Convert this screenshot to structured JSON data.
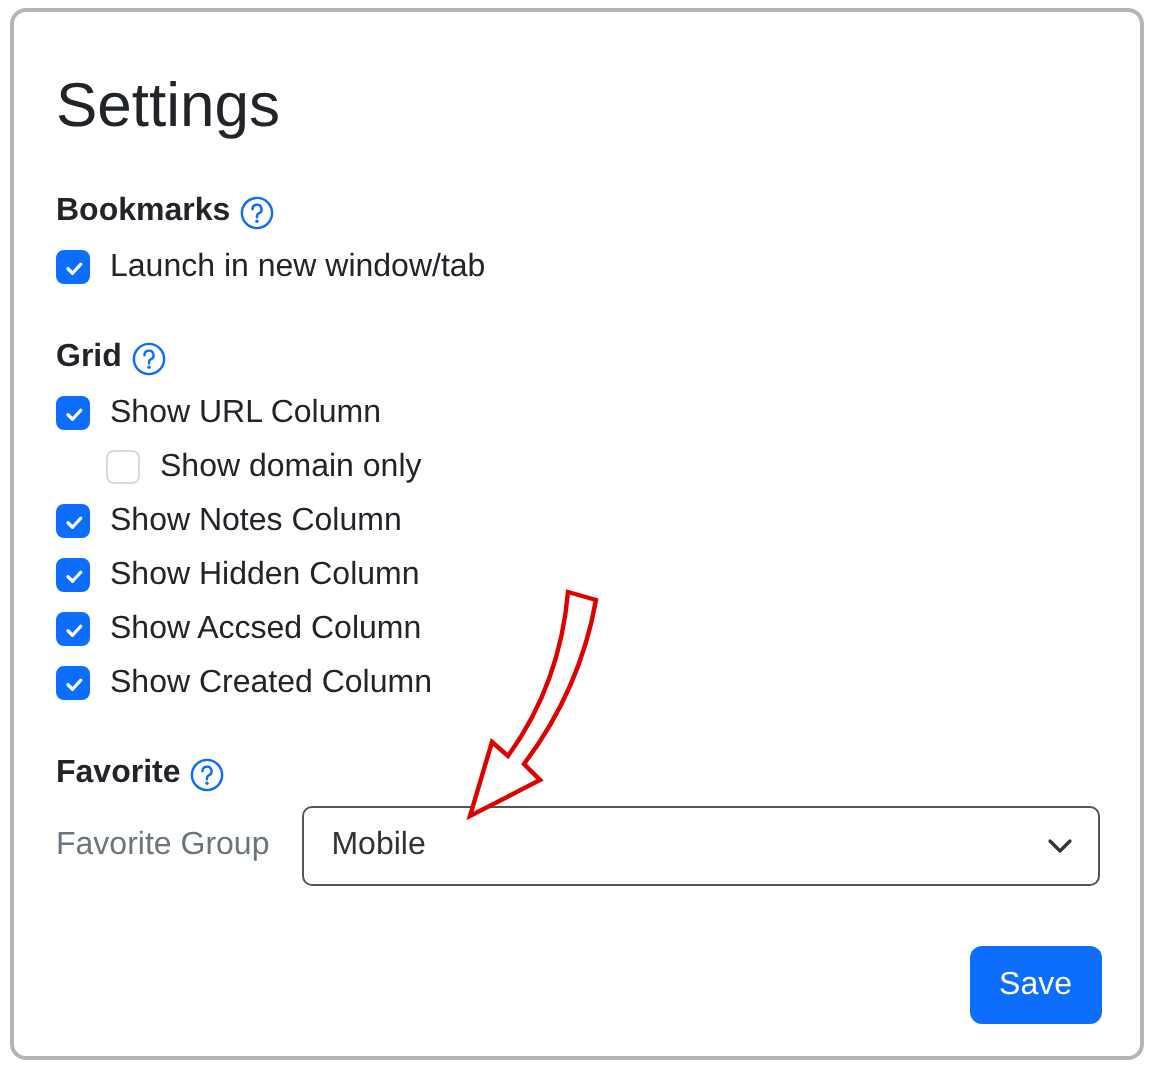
{
  "title": "Settings",
  "sections": [
    {
      "kind": "checkboxes",
      "title": "Bookmarks",
      "items": [
        {
          "label": "Launch in new window/tab",
          "checked": true
        }
      ]
    },
    {
      "kind": "checkboxes",
      "title": "Grid",
      "items": [
        {
          "label": "Show URL Column",
          "checked": true,
          "children": [
            {
              "label": "Show domain only",
              "checked": false
            }
          ]
        },
        {
          "label": "Show Notes Column",
          "checked": true
        },
        {
          "label": "Show Hidden Column",
          "checked": true
        },
        {
          "label": "Show Accsed Column",
          "checked": true
        },
        {
          "label": "Show Created Column",
          "checked": true
        }
      ]
    },
    {
      "kind": "select",
      "title": "Favorite",
      "field_label": "Favorite Group",
      "value": "Mobile"
    }
  ],
  "save_button": "Save"
}
